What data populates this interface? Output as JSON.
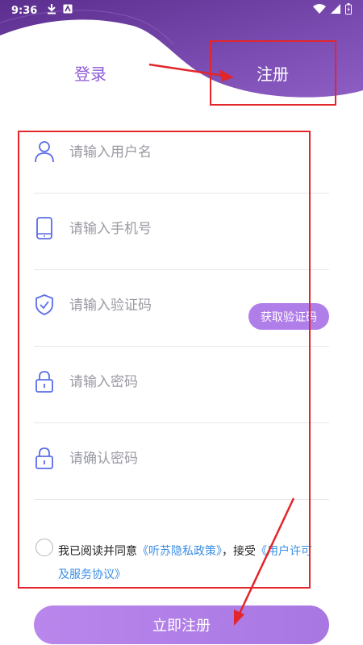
{
  "status_bar": {
    "time": "9:36"
  },
  "tabs": {
    "login": "登录",
    "register": "注册"
  },
  "form": {
    "username_placeholder": "请输入用户名",
    "phone_placeholder": "请输入手机号",
    "code_placeholder": "请输入验证码",
    "get_code_label": "获取验证码",
    "password_placeholder": "请输入密码",
    "confirm_placeholder": "请确认密码"
  },
  "agreement": {
    "prefix": "我已阅读并同意",
    "privacy_link": "《听苏隐私政策》",
    "middle": "，接受",
    "terms_link": "《用户许可及服务协议》"
  },
  "submit_label": "立即注册",
  "icons": {
    "user": "user-icon",
    "phone": "phone-icon",
    "shield": "shield-check-icon",
    "lock": "lock-icon",
    "download": "download-icon",
    "wifi": "wifi-icon",
    "signal": "signal-icon",
    "battery": "battery-icon"
  },
  "colors": {
    "accent": "#8e5bd6",
    "button": "#b07ee8",
    "link": "#3a8ee6",
    "annotation": "#e2262b"
  }
}
